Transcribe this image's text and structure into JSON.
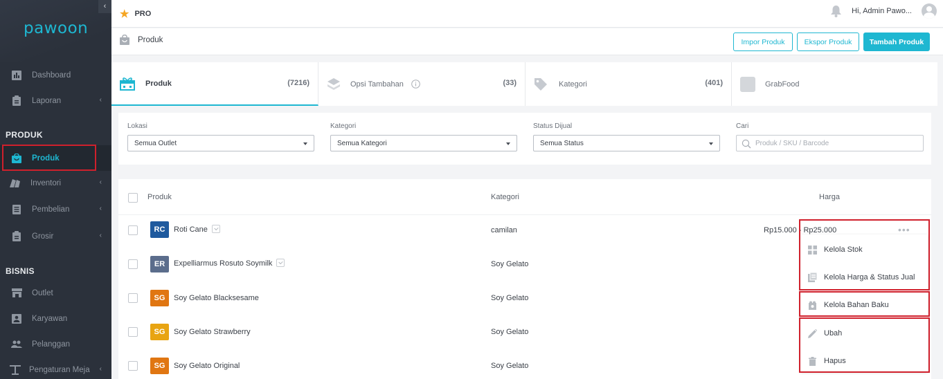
{
  "sidebar": {
    "logo": "pawoon",
    "collapse_glyph": "‹",
    "sections": {
      "produk": "PRODUK",
      "bisnis": "BISNIS"
    },
    "items": [
      {
        "label": "Dashboard",
        "icon": "chart-icon"
      },
      {
        "label": "Laporan",
        "icon": "clipboard-icon"
      },
      {
        "label": "Produk",
        "icon": "shopping-bag-icon"
      },
      {
        "label": "Inventori",
        "icon": "boxes-icon"
      },
      {
        "label": "Pembelian",
        "icon": "document-icon"
      },
      {
        "label": "Grosir",
        "icon": "clipboard-icon"
      },
      {
        "label": "Outlet",
        "icon": "store-icon"
      },
      {
        "label": "Karyawan",
        "icon": "id-card-icon"
      },
      {
        "label": "Pelanggan",
        "icon": "people-icon"
      },
      {
        "label": "Pengaturan Meja",
        "icon": "table-icon"
      }
    ],
    "chevron": "‹"
  },
  "topbar": {
    "plan": "PRO",
    "greeting": "Hi, Admin Pawo..."
  },
  "page": {
    "title": "Produk",
    "buttons": {
      "import": "Impor Produk",
      "export": "Ekspor Produk",
      "add": "Tambah Produk"
    }
  },
  "tabs": [
    {
      "label": "Produk",
      "count": "(7216)"
    },
    {
      "label": "Opsi Tambahan",
      "count": "(33)"
    },
    {
      "label": "Kategori",
      "count": "(401)"
    },
    {
      "label": "GrabFood",
      "count": ""
    }
  ],
  "filters": {
    "lokasi": {
      "label": "Lokasi",
      "value": "Semua Outlet"
    },
    "kategori": {
      "label": "Kategori",
      "value": "Semua Kategori"
    },
    "status": {
      "label": "Status Dijual",
      "value": "Semua Status"
    },
    "cari": {
      "label": "Cari",
      "placeholder": "Produk / SKU / Barcode"
    }
  },
  "table": {
    "columns": {
      "produk": "Produk",
      "kategori": "Kategori",
      "harga": "Harga"
    },
    "rows": [
      {
        "initials": "RC",
        "name": "Roti Cane",
        "category": "camilan",
        "price": "Rp15.000 - Rp25.000",
        "color": "#1f5a9e",
        "variant": true
      },
      {
        "initials": "ER",
        "name": "Expelliarmus Rosuto Soymilk",
        "category": "Soy Gelato",
        "price": "",
        "color": "#5b6d8c",
        "variant": true
      },
      {
        "initials": "SG",
        "name": "Soy Gelato Blacksesame",
        "category": "Soy Gelato",
        "price": "",
        "color": "#e07612",
        "variant": false
      },
      {
        "initials": "SG",
        "name": "Soy Gelato Strawberry",
        "category": "Soy Gelato",
        "price": "",
        "color": "#e8a412",
        "variant": false
      },
      {
        "initials": "SG",
        "name": "Soy Gelato Original",
        "category": "Soy Gelato",
        "price": "",
        "color": "#e07612",
        "variant": false
      }
    ],
    "more_glyph": "•••"
  },
  "row_menu": {
    "items": [
      {
        "label": "Kelola Stok",
        "icon": "grid-icon"
      },
      {
        "label": "Kelola Harga & Status Jual",
        "icon": "price-tag-icon"
      },
      {
        "label": "Kelola Bahan Baku",
        "icon": "ingredients-icon"
      },
      {
        "label": "Ubah",
        "icon": "pencil-icon"
      },
      {
        "label": "Hapus",
        "icon": "trash-icon"
      }
    ]
  },
  "colors": {
    "accent": "#1eb7d1",
    "sidebar_bg": "#2b313b",
    "highlight": "#d0202c"
  }
}
